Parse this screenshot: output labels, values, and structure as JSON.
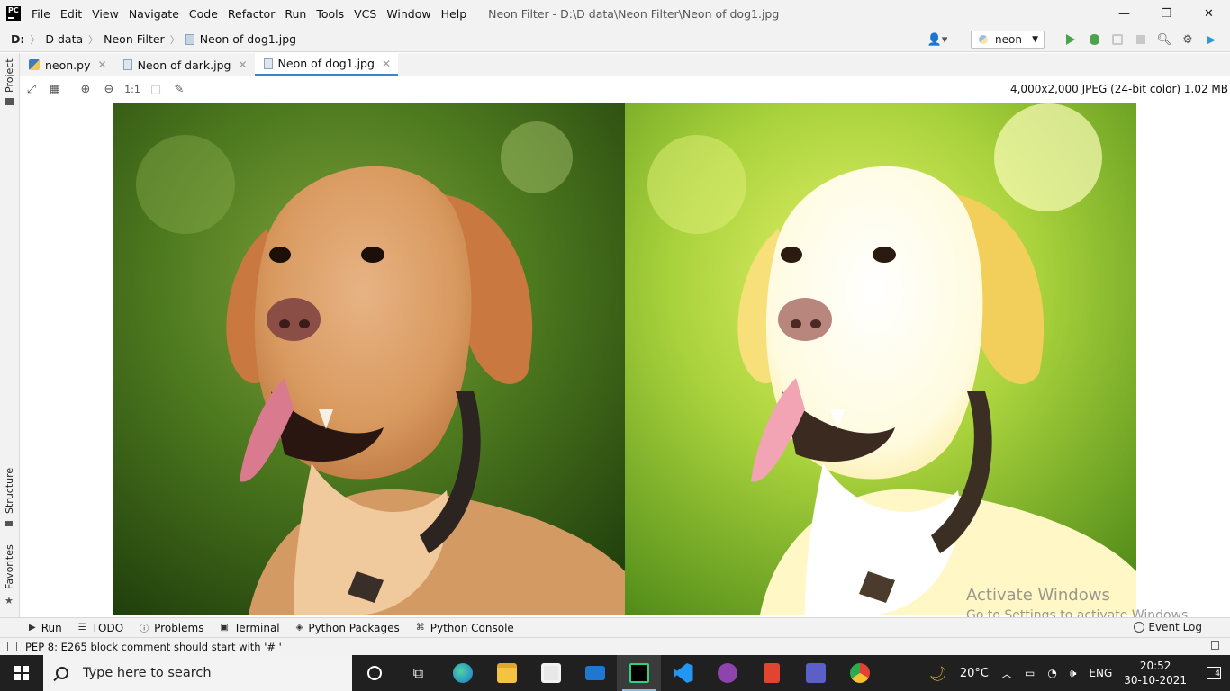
{
  "app": {
    "logo_text": "PC",
    "window_title": "Neon Filter - D:\\D data\\Neon Filter\\Neon of dog1.jpg",
    "menu": [
      "File",
      "Edit",
      "View",
      "Navigate",
      "Code",
      "Refactor",
      "Run",
      "Tools",
      "VCS",
      "Window",
      "Help"
    ]
  },
  "window_controls": {
    "minimize": "—",
    "restore": "❐",
    "close": "✕"
  },
  "breadcrumb": {
    "drive": "D:",
    "folder1": "D data",
    "folder2": "Neon Filter",
    "file": "Neon of dog1.jpg"
  },
  "run_config": {
    "name": "neon"
  },
  "left_strip": {
    "project": "Project",
    "structure": "Structure",
    "favorites": "Favorites"
  },
  "tabs": [
    {
      "label": "neon.py",
      "kind": "python"
    },
    {
      "label": "Neon of dark.jpg",
      "kind": "image"
    },
    {
      "label": "Neon of dog1.jpg",
      "kind": "image",
      "active": true
    }
  ],
  "image_toolbar": {
    "actual_size": "1:1"
  },
  "image_info": "4,000x2,000 JPEG (24-bit color) 1.02 MB",
  "watermark": {
    "line1": "Activate Windows",
    "line2": "Go to Settings to activate Windows."
  },
  "tool_windows": [
    "Run",
    "TODO",
    "Problems",
    "Terminal",
    "Python Packages",
    "Python Console"
  ],
  "event_log": "Event Log",
  "status_message": "PEP 8: E265 block comment should start with '# '",
  "taskbar": {
    "search_placeholder": "Type here to search",
    "weather": "20°C",
    "language": "ENG",
    "time": "20:52",
    "date": "30-10-2021",
    "notifications": "4"
  }
}
